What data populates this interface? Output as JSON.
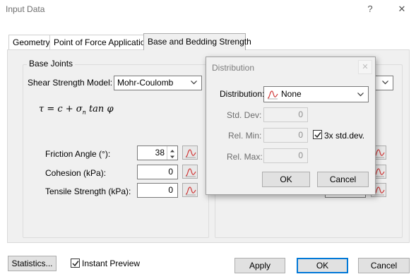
{
  "window": {
    "title": "Input Data",
    "help_label": "?",
    "close_label": "✕"
  },
  "tabs": [
    {
      "label": "Geometry"
    },
    {
      "label": "Point of Force Application"
    },
    {
      "label": "Base and Bedding Strength"
    }
  ],
  "base_joints": {
    "title": "Base Joints",
    "shear_model_label": "Shear Strength Model:",
    "shear_model_value": "Mohr-Coulomb",
    "formula": {
      "lhs": "τ = c + σ",
      "subscript": "n",
      "rhs": " tan φ"
    },
    "friction_label": "Friction Angle (°):",
    "friction_value": "38",
    "cohesion_label": "Cohesion (kPa):",
    "cohesion_value": "0",
    "tensile_label": "Tensile Strength (kPa):",
    "tensile_value": "0"
  },
  "distribution_dialog": {
    "title": "Distribution",
    "close_label": "✕",
    "distribution_label": "Distribution:",
    "distribution_value": "None",
    "std_dev_label": "Std. Dev:",
    "std_dev_value": "0",
    "rel_min_label": "Rel. Min:",
    "rel_min_value": "0",
    "std_dev_check_label": "3x std.dev.",
    "std_dev_checked": true,
    "rel_max_label": "Rel. Max:",
    "rel_max_value": "0",
    "ok_label": "OK",
    "cancel_label": "Cancel"
  },
  "footer": {
    "statistics_label": "Statistics...",
    "instant_preview_label": "Instant Preview",
    "instant_preview_checked": true,
    "apply_label": "Apply",
    "ok_label": "OK",
    "cancel_label": "Cancel"
  },
  "colors": {
    "focus_blue": "#0078d7",
    "dist_icon_red": "#d13a3a",
    "panel_bg": "#f0f0f0"
  }
}
